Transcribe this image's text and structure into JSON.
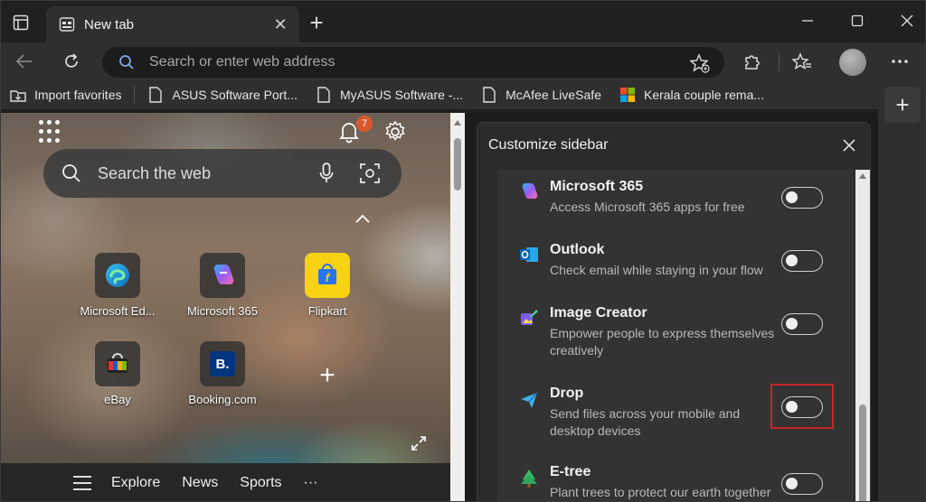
{
  "tab": {
    "title": "New tab",
    "close_glyph": "✕"
  },
  "newtab_glyph": "+",
  "address": {
    "placeholder": "Search or enter web address"
  },
  "favorites": [
    {
      "label": "Import favorites",
      "icon": "import-favorites-icon"
    },
    {
      "label": "ASUS Software Port...",
      "icon": "page-icon"
    },
    {
      "label": "MyASUS Software -...",
      "icon": "page-icon"
    },
    {
      "label": "McAfee LiveSafe",
      "icon": "page-icon"
    },
    {
      "label": "Kerala couple rema...",
      "icon": "msn-logo-icon"
    }
  ],
  "sidebar_add_glyph": "+",
  "newtab_page": {
    "notification_count": "7",
    "search_placeholder": "Search the web",
    "tiles": [
      {
        "label": "Microsoft Ed...",
        "icon": "edge-logo-icon"
      },
      {
        "label": "Microsoft 365",
        "icon": "copilot-logo-icon"
      },
      {
        "label": "Flipkart",
        "icon": "flipkart-logo-icon"
      },
      {
        "label": "eBay",
        "icon": "ebay-logo-icon"
      },
      {
        "label": "Booking.com",
        "icon": "booking-logo-icon",
        "badge": "B."
      }
    ],
    "add_tile_glyph": "+",
    "feed": [
      "Explore",
      "News",
      "Sports",
      "···"
    ]
  },
  "customize_sidebar": {
    "title": "Customize sidebar",
    "items": [
      {
        "name": "Microsoft 365",
        "desc": "Access Microsoft 365 apps for free",
        "icon": "microsoft-365-icon",
        "enabled": false
      },
      {
        "name": "Outlook",
        "desc": "Check email while staying in your flow",
        "icon": "outlook-icon",
        "enabled": false
      },
      {
        "name": "Image Creator",
        "desc": "Empower people to express themselves creatively",
        "icon": "image-creator-icon",
        "enabled": false
      },
      {
        "name": "Drop",
        "desc": "Send files across your mobile and desktop devices",
        "icon": "drop-icon",
        "enabled": false,
        "highlighted": true
      },
      {
        "name": "E-tree",
        "desc": "Plant trees to protect our earth together",
        "icon": "e-tree-icon",
        "enabled": false
      }
    ]
  },
  "colors": {
    "highlight": "#c9252b",
    "badge": "#d9582b"
  }
}
